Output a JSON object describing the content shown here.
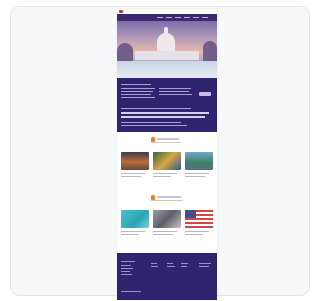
{
  "preview": {
    "site_logo_color": "#c0392b",
    "nav_color": "#3b2b6e",
    "footer_color": "#2e2470",
    "accent": "#e67e22",
    "hero_image": "capitol-dome-at-sunset",
    "section_1_images": [
      "sunset-landscape-photo",
      "nature-photo",
      "lake-photo"
    ],
    "section_2_images": [
      "teal-graphic-photo",
      "people-photo",
      "american-flag-photo"
    ]
  }
}
